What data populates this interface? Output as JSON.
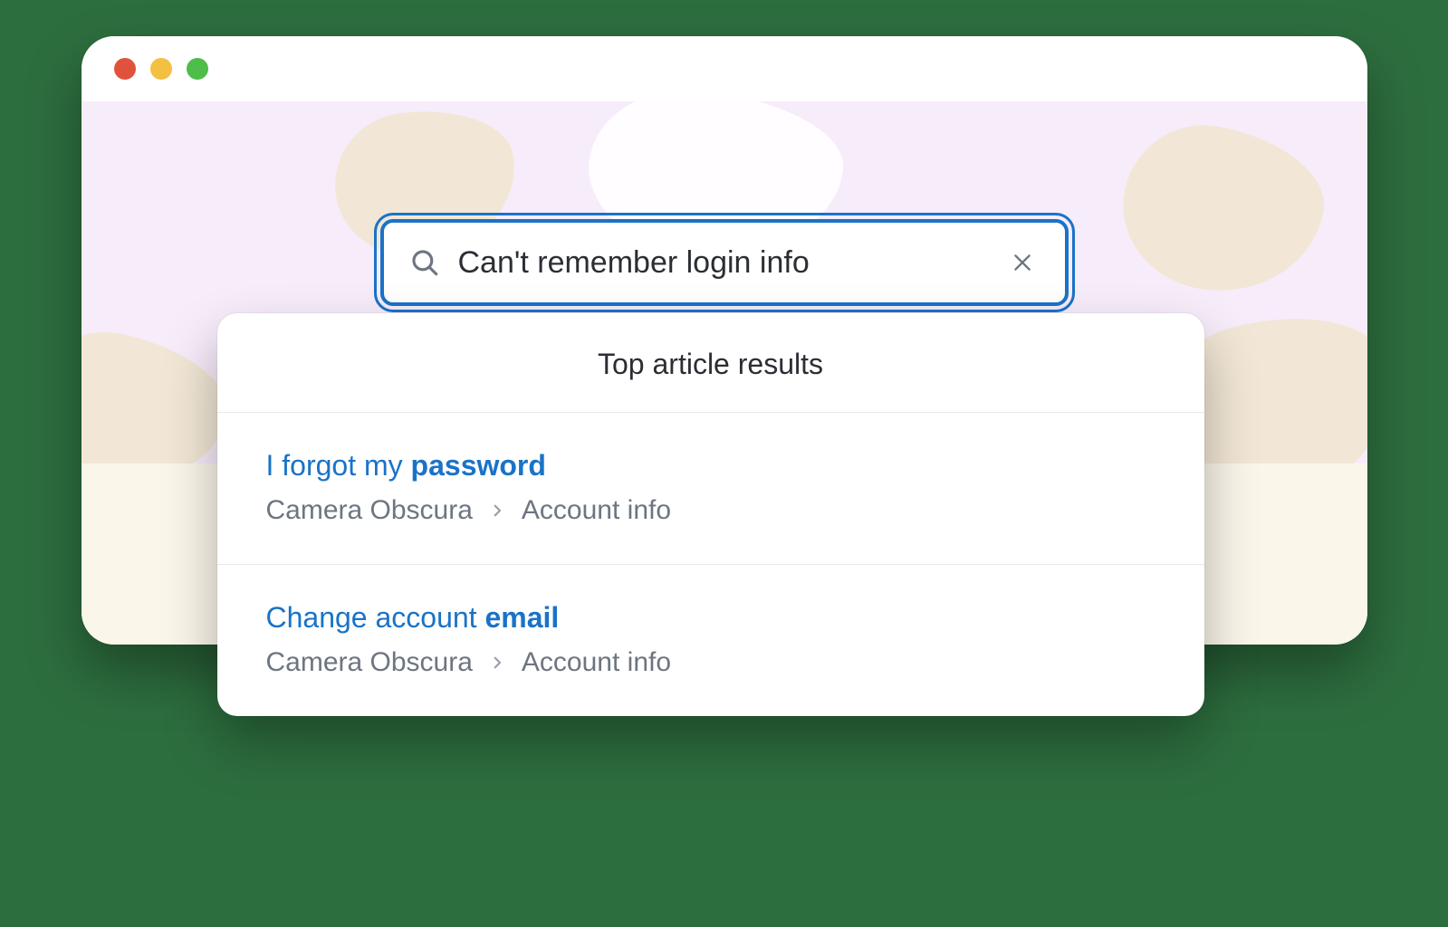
{
  "search": {
    "value": "Can't remember login info"
  },
  "dropdown": {
    "header": "Top article results",
    "results": [
      {
        "title_prefix": "I forgot my ",
        "title_highlight": "password",
        "crumb_parent": "Camera Obscura",
        "crumb_child": "Account info"
      },
      {
        "title_prefix": "Change account ",
        "title_highlight": "email",
        "crumb_parent": "Camera Obscura",
        "crumb_child": "Account info"
      }
    ]
  }
}
